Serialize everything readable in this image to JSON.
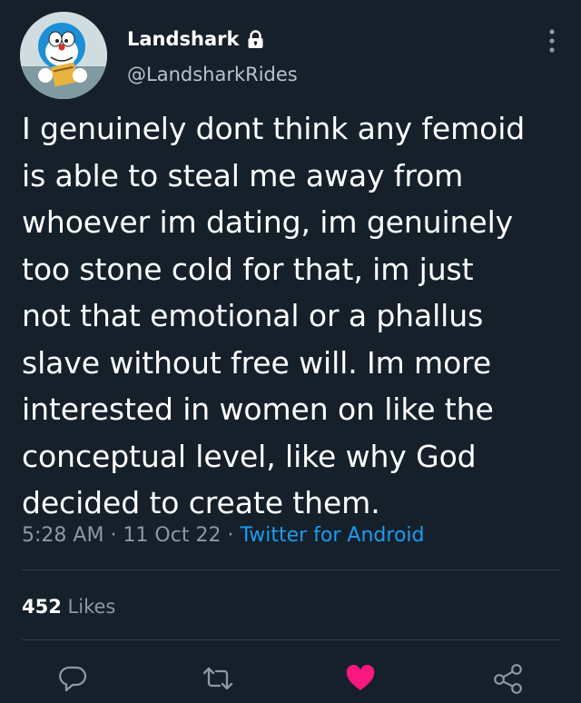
{
  "header": {
    "display_name": "Landshark",
    "handle": "@LandsharkRides",
    "verified_lock_icon": "lock-icon",
    "more_icon": "vertical-dots-icon"
  },
  "tweet": {
    "lines": [
      "I genuinely dont think any femoid",
      "is able to steal me away from",
      "whoever im dating, im genuinely",
      "too stone cold for that, im just",
      "not that emotional or a phallus",
      "slave without free will. Im more",
      "interested in women on like the",
      "conceptual level, like why God",
      "decided to create them."
    ]
  },
  "meta": {
    "time": "5:28 AM",
    "separator": "·",
    "date": "11 Oct 22",
    "source": "Twitter for Android"
  },
  "stats": {
    "likes_count": "452",
    "likes_label": "Likes"
  },
  "actions": [
    {
      "name": "reply-icon"
    },
    {
      "name": "retweet-icon"
    },
    {
      "name": "like-icon",
      "active": true
    },
    {
      "name": "share-icon"
    }
  ],
  "colors": {
    "background": "#15202b",
    "text": "#ffffff",
    "secondary": "#8b98a5",
    "link": "#1d9bf0",
    "like": "#f91880",
    "divider": "#2f3b47"
  }
}
